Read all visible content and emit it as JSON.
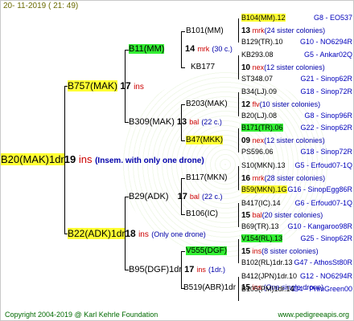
{
  "header": {
    "date": "20- 11-2019 ( 21: 49)"
  },
  "footer": {
    "copyright": "Copyright 2004-2019 @ Karl Kehrle Foundation",
    "url": "www.pedigreeapis.org"
  },
  "root": {
    "label": "B20(MAK)1dr",
    "num": "19",
    "ins": "ins",
    "note": "(Insem. with only one drone)"
  },
  "gen1": [
    {
      "label": "B757(MAK)",
      "num": "17",
      "ins": "ins"
    },
    {
      "label": "B22(ADK)1dr",
      "num": "18",
      "ins": "ins",
      "note": "(Only one drone)"
    }
  ],
  "gen2": [
    {
      "label": "B11(MM)",
      "num": "14",
      "ins": "mrk",
      "note": "(30 c.)"
    },
    {
      "label": "B309(MAK)",
      "num": "13",
      "ins": "bal",
      "note": "(22 c.)"
    },
    {
      "label": "B29(ADK)",
      "num": "17",
      "ins": "bal",
      "note": "(22 c.)"
    },
    {
      "label": "B95(DGF)1dr",
      "num": "17",
      "ins": "ins",
      "note": "(1dr.)"
    }
  ],
  "gen3": [
    {
      "label": "B101(MM)"
    },
    {
      "label": "KB177"
    },
    {
      "label": "B203(MAK)"
    },
    {
      "label": "B47(MKK)"
    },
    {
      "label": "B117(MKN)"
    },
    {
      "label": "B106(IC)"
    },
    {
      "label": "V555(DGF)"
    },
    {
      "label": "B519(ABR)1dr",
      "num": "15",
      "ins": "ins",
      "note": "(One single drone)"
    }
  ],
  "gen4": [
    {
      "name": "B104(MM).12",
      "code": "G8 - EO537"
    },
    {
      "num": "13",
      "ins": "mrk",
      "note": "(24 sister colonies)"
    },
    {
      "name": "B129(TR).10",
      "code": "G10 - NO6294R"
    },
    {
      "name": "KB293.08",
      "code": "G5 - Ankar02Q"
    },
    {
      "num": "10",
      "ins": "nex",
      "note": "(12 sister colonies)"
    },
    {
      "name": "ST348.07",
      "code": "G21 - Sinop62R"
    },
    {
      "name": "B34(LJ).09",
      "code": "G18 - Sinop72R"
    },
    {
      "num": "12",
      "ins": "flv",
      "note": "(10 sister colonies)"
    },
    {
      "name": "B20(LJ).08",
      "code": "G8 - Sinop96R"
    },
    {
      "name": "B171(TR).06",
      "code": "G22 - Sinop62R"
    },
    {
      "num": "09",
      "ins": "nex",
      "note": "(12 sister colonies)"
    },
    {
      "name": "PS596.06",
      "code": "G18 - Sinop72R"
    },
    {
      "name": "S10(MKN).13",
      "code": "G5 - Erfoud07-1Q"
    },
    {
      "num": "16",
      "ins": "mrk",
      "note": "(28 sister colonies)"
    },
    {
      "name": "B59(MKN).1G",
      "code": "G16 - SinopEgg86R"
    },
    {
      "name": "B417(IC).14",
      "code": "G6 - Erfoud07-1Q"
    },
    {
      "num": "15",
      "ins": "bal",
      "note": "(20 sister colonies)"
    },
    {
      "name": "B69(TR).13",
      "code": "G10 - Kangaroo98R"
    },
    {
      "name": "V154(RL).13",
      "code": "G25 - Sinop62R"
    },
    {
      "num": "15",
      "ins": "ins",
      "note": "(8 sister colonies)"
    },
    {
      "name": "B102(RL)1dr.13",
      "code": "G47 - AthosSt80R"
    },
    {
      "name": "B412(JPN)1dr.10",
      "code": "G12 - NO6294R"
    },
    {
      "name": "B105(PM)1dr.14",
      "code": "G4 - PrimGreen00"
    }
  ]
}
